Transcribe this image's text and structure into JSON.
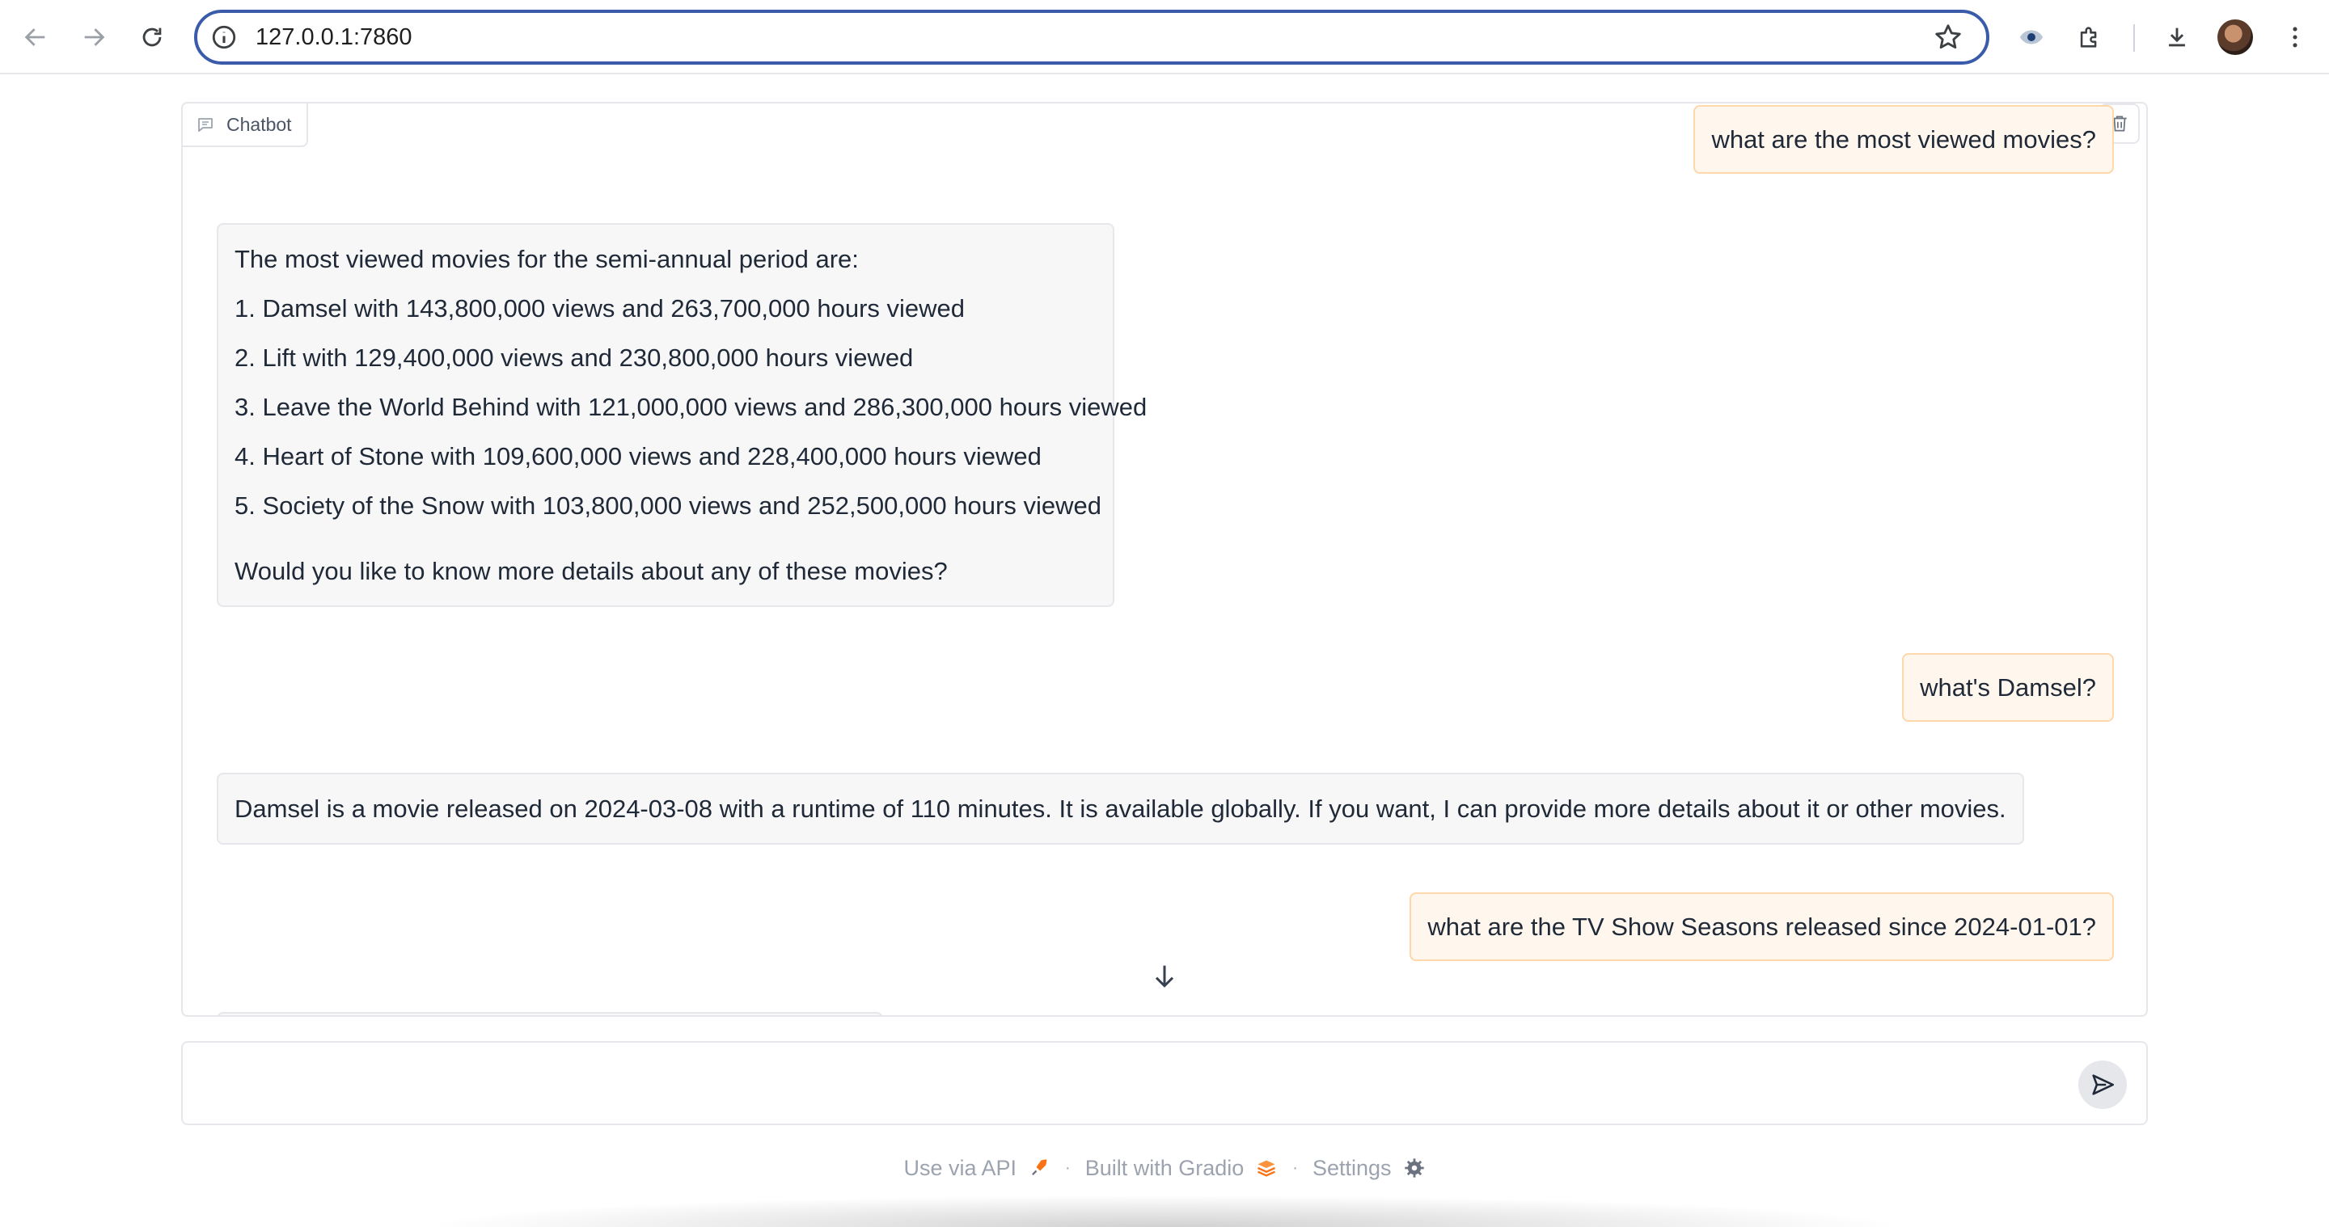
{
  "browser": {
    "url": "127.0.0.1:7860"
  },
  "chatbot": {
    "label": "Chatbot",
    "messages": [
      {
        "role": "user",
        "text": "what are the most viewed movies?"
      },
      {
        "role": "bot",
        "lines": [
          "The most viewed movies for the semi-annual period are:",
          "1. Damsel with 143,800,000 views and 263,700,000 hours viewed",
          "2. Lift with 129,400,000 views and 230,800,000 hours viewed",
          "3. Leave the World Behind with 121,000,000 views and 286,300,000 hours viewed",
          "4. Heart of Stone with 109,600,000 views and 228,400,000 hours viewed",
          "5. Society of the Snow with 103,800,000 views and 252,500,000 hours viewed",
          "Would you like to know more details about any of these movies?"
        ]
      },
      {
        "role": "user",
        "text": "what's Damsel?"
      },
      {
        "role": "bot",
        "lines": [
          "Damsel is a movie released on 2024-03-08 with a runtime of 110 minutes. It is available globally. If you want, I can provide more details about it or other movies."
        ]
      },
      {
        "role": "user",
        "text": "what are the TV Show Seasons released since 2024-01-01?"
      }
    ]
  },
  "input": {
    "placeholder": "",
    "value": ""
  },
  "footer": {
    "api_label": "Use via API",
    "built_label": "Built with Gradio",
    "settings_label": "Settings",
    "separator": "·"
  },
  "icons": {
    "back": "arrow-left-icon",
    "forward": "arrow-right-icon",
    "reload": "reload-icon",
    "site_info": "info-icon",
    "bookmark": "star-icon",
    "extension_eye": "eye-icon",
    "extensions": "puzzle-icon",
    "downloads": "download-icon",
    "menu": "kebab-menu-icon"
  },
  "colors": {
    "accent": "#3a5ba9",
    "user_bubble": "#fff7ed",
    "user_border": "#fed7aa",
    "bot_bubble": "#f7f7f7"
  }
}
